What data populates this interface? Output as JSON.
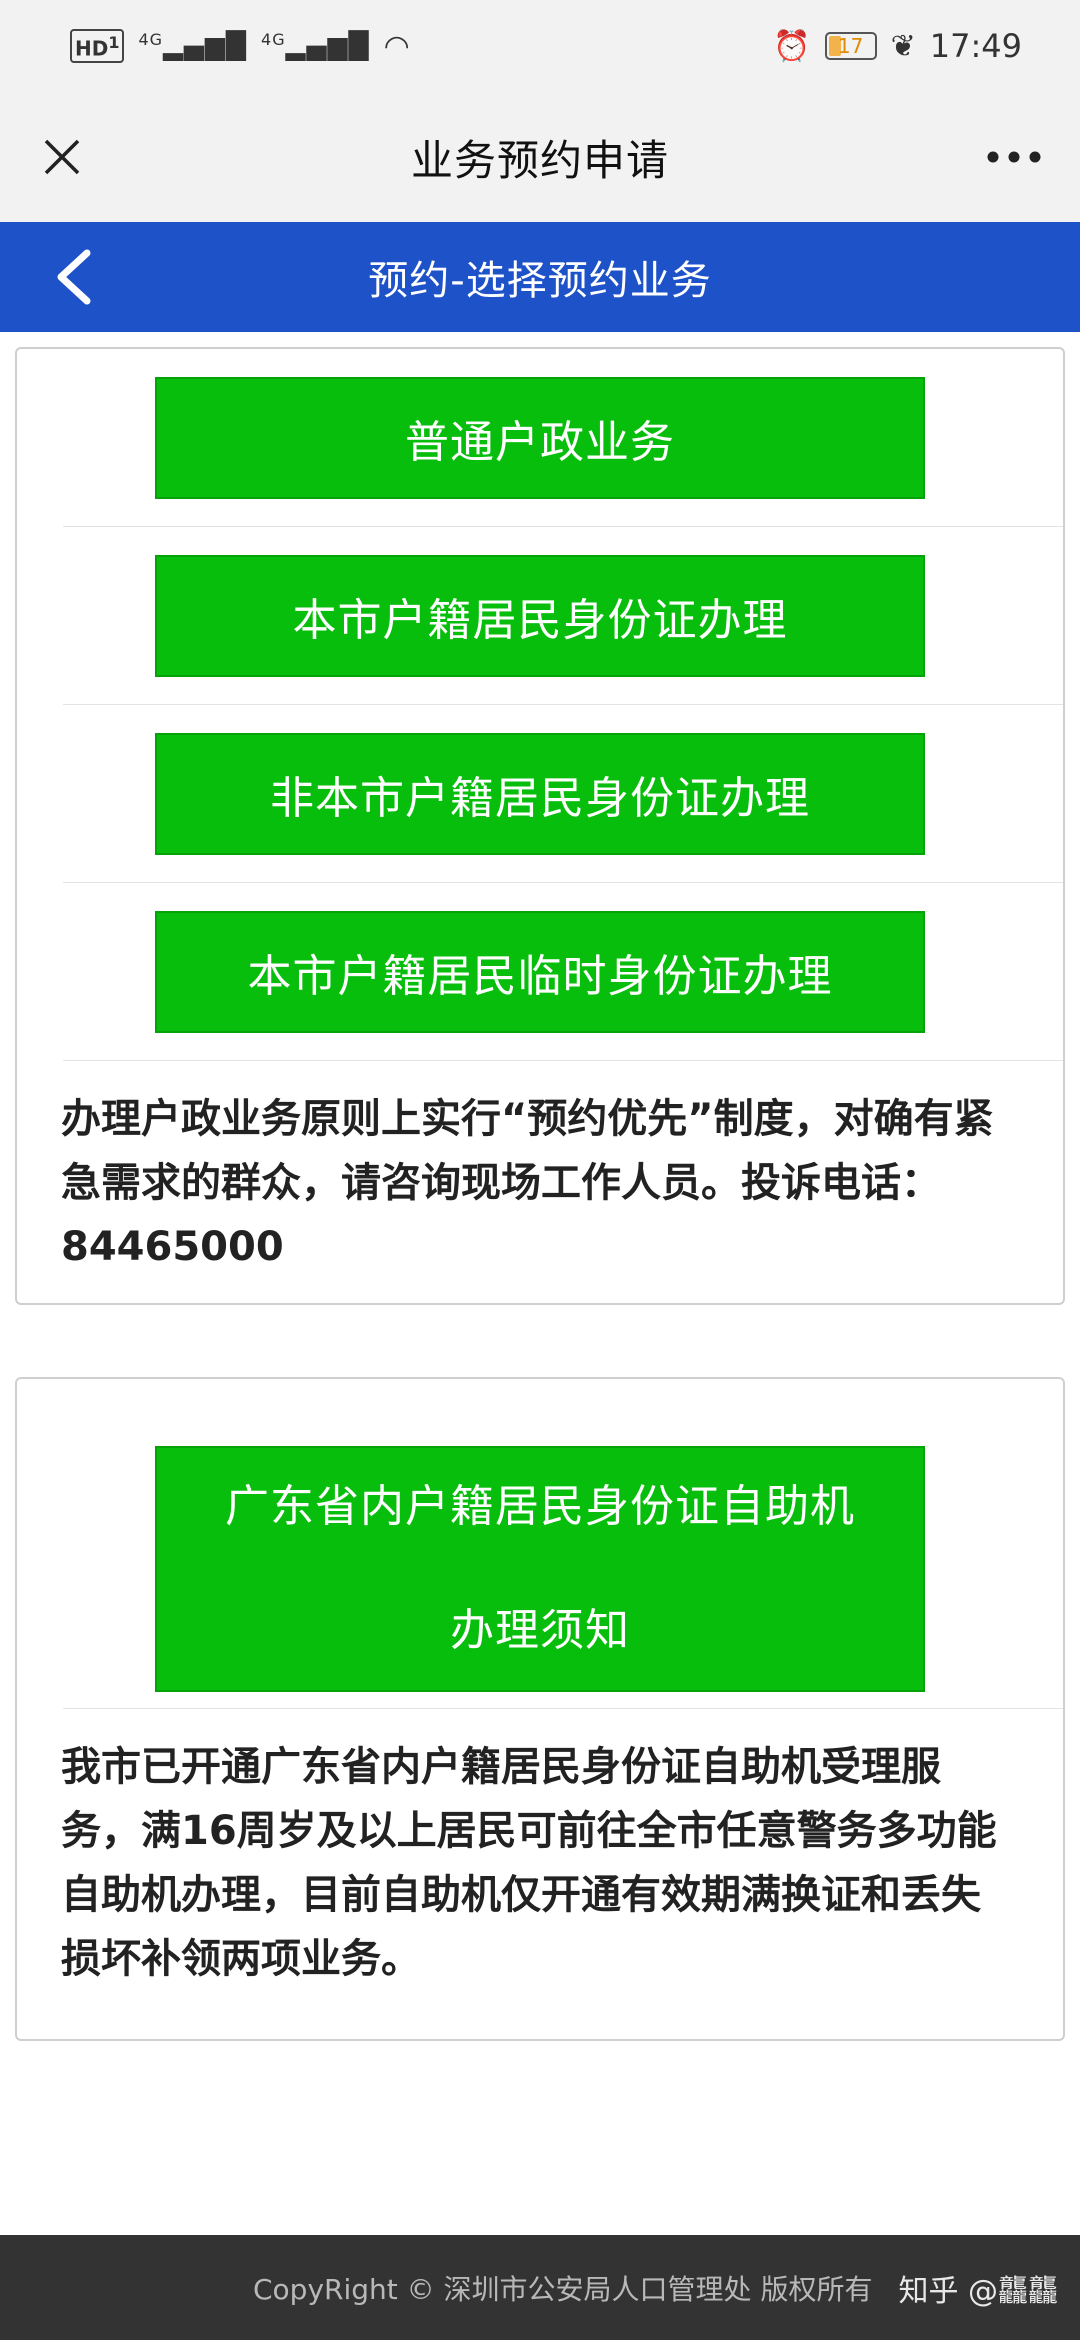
{
  "status_bar": {
    "hd_badge": "HD",
    "hd_sub": "1",
    "sig1_label": "4G",
    "sig1_bars": "▂▄▆█",
    "sig2_label": "4G",
    "sig2_bars": "▂▄▆█",
    "wifi_glyph": "◠",
    "alarm_glyph": "⏰",
    "battery_level": "17",
    "leaf_glyph": "❦",
    "time": "17:49"
  },
  "title_bar": {
    "title": "业务预约申请",
    "close_icon": "close-icon",
    "more_icon": "more-icon"
  },
  "header": {
    "title": "预约-选择预约业务",
    "back_icon": "chevron-left-icon",
    "color": "#1e52c8"
  },
  "panel1": {
    "buttons": [
      {
        "label": "普通户政业务"
      },
      {
        "label": "本市户籍居民身份证办理"
      },
      {
        "label": "非本市户籍居民身份证办理"
      },
      {
        "label": "本市户籍居民临时身份证办理"
      }
    ],
    "notice": "办理户政业务原则上实行“预约优先”制度，对确有紧急需求的群众，请咨询现场工作人员。投诉电话：84465000"
  },
  "panel2": {
    "button_line1": "广东省内户籍居民身份证自助机",
    "button_line2": "办理须知",
    "notice": "我市已开通广东省内户籍居民身份证自助机受理服务，满16周岁及以上居民可前往全市任意警务多功能自助机办理，目前自助机仅开通有效期满换证和丢失损坏补领两项业务。"
  },
  "footer": {
    "copyright": "CopyRight © 深圳市公安局人口管理处 版权所有",
    "watermark": "知乎 @龘龘"
  },
  "colors": {
    "button_green": "#08be0c",
    "footer_bg": "#333333"
  }
}
